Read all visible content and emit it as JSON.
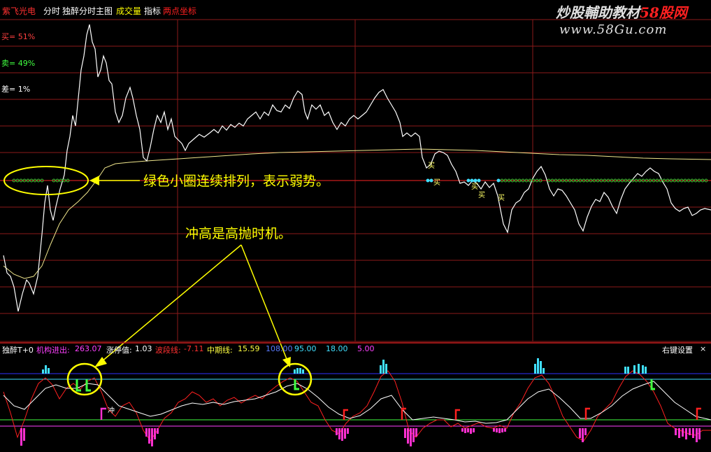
{
  "header": {
    "stock_name": "紫飞光电",
    "items": [
      "分时",
      "独醉分时主图",
      "成交量",
      "指标",
      "两点坐标"
    ],
    "colors": {
      "stock": "#ff3030",
      "item": "#ffffff",
      "volume": "#ffff00",
      "twopoint": "#ff2020"
    }
  },
  "watermark": {
    "title_prefix": "炒股輔助教材",
    "title_suffix": "58股网",
    "url": "www.58Gu.com"
  },
  "main_indicators": {
    "buy": "买= 51%",
    "sell": "卖= 49%",
    "diff": "差= 1%"
  },
  "annotations": {
    "weak_note": "绿色小圈连续排列，表示弱势。",
    "sell_note": "冲高是高抛时机。"
  },
  "signal_tags": {
    "buy": "买",
    "chong": "冲"
  },
  "lower_panel": {
    "name": "独醉T+0",
    "inst_label": "机构进出:",
    "inst_value": "263.07",
    "limit_label": "涨停值:",
    "limit_value": "1.03",
    "wave_label": "波段线:",
    "wave_value": "-7.11",
    "mid_label": "中期线:",
    "mid_value": "15.59",
    "levels": [
      "108.00",
      "95.00",
      "18.00",
      "5.00"
    ],
    "right_menu": "右键设置",
    "close": "×"
  }
}
